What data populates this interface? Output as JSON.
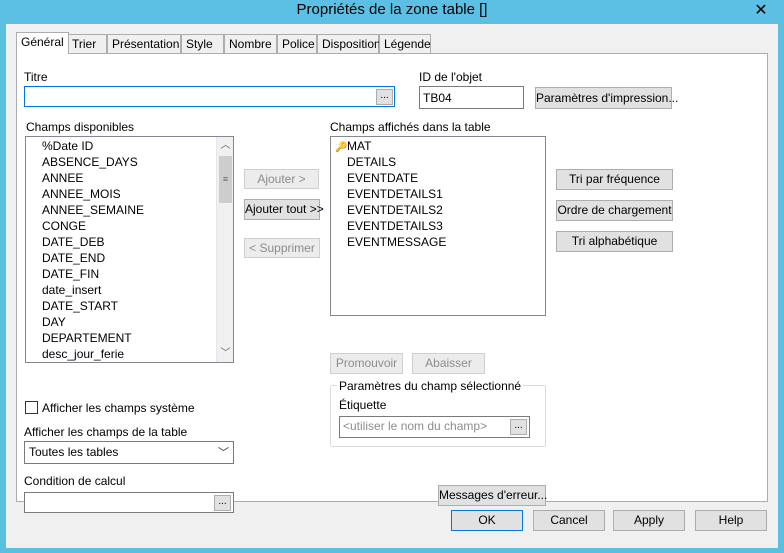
{
  "window": {
    "title": "Propriétés de la zone table []",
    "close_glyph": "✕"
  },
  "tabs": [
    {
      "label": "Général"
    },
    {
      "label": "Trier"
    },
    {
      "label": "Présentation"
    },
    {
      "label": "Style"
    },
    {
      "label": "Nombre"
    },
    {
      "label": "Police"
    },
    {
      "label": "Disposition"
    },
    {
      "label": "Légende"
    }
  ],
  "general": {
    "titre_label": "Titre",
    "titre_value": "",
    "browse_glyph": "...",
    "object_id_label": "ID de l'objet",
    "object_id_value": "TB04",
    "print_params_button": "Paramètres d'impression...",
    "available_fields_label": "Champs disponibles",
    "available_fields": [
      "%Date ID",
      "ABSENCE_DAYS",
      "ANNEE",
      "ANNEE_MOIS",
      "ANNEE_SEMAINE",
      "CONGE",
      "DATE_DEB",
      "DATE_END",
      "DATE_FIN",
      "date_insert",
      "DATE_START",
      "DAY",
      "DEPARTEMENT",
      "desc_jour_ferie"
    ],
    "add_button": "Ajouter >",
    "add_all_button": "Ajouter tout >>",
    "remove_button": "< Supprimer",
    "displayed_fields_label": "Champs affichés dans la table",
    "displayed_fields": [
      "MAT",
      "DETAILS",
      "EVENTDATE",
      "EVENTDETAILS1",
      "EVENTDETAILS2",
      "EVENTDETAILS3",
      "EVENTMESSAGE"
    ],
    "sort_frequency_button": "Tri par fréquence",
    "load_order_button": "Ordre de chargement",
    "sort_alpha_button": "Tri alphabétique",
    "promote_button": "Promouvoir",
    "demote_button": "Abaisser",
    "selected_field_group": "Paramètres du champ sélectionné",
    "label_label": "Étiquette",
    "label_placeholder": "<utiliser le nom du champ>",
    "show_system_fields_label": "Afficher les champs système",
    "show_table_fields_label": "Afficher les champs de la table",
    "table_select_value": "Toutes les tables",
    "calc_condition_label": "Condition de calcul",
    "calc_condition_value": "",
    "error_messages_button": "Messages d'erreur..."
  },
  "footer": {
    "ok": "OK",
    "cancel": "Cancel",
    "apply": "Apply",
    "help": "Help"
  }
}
